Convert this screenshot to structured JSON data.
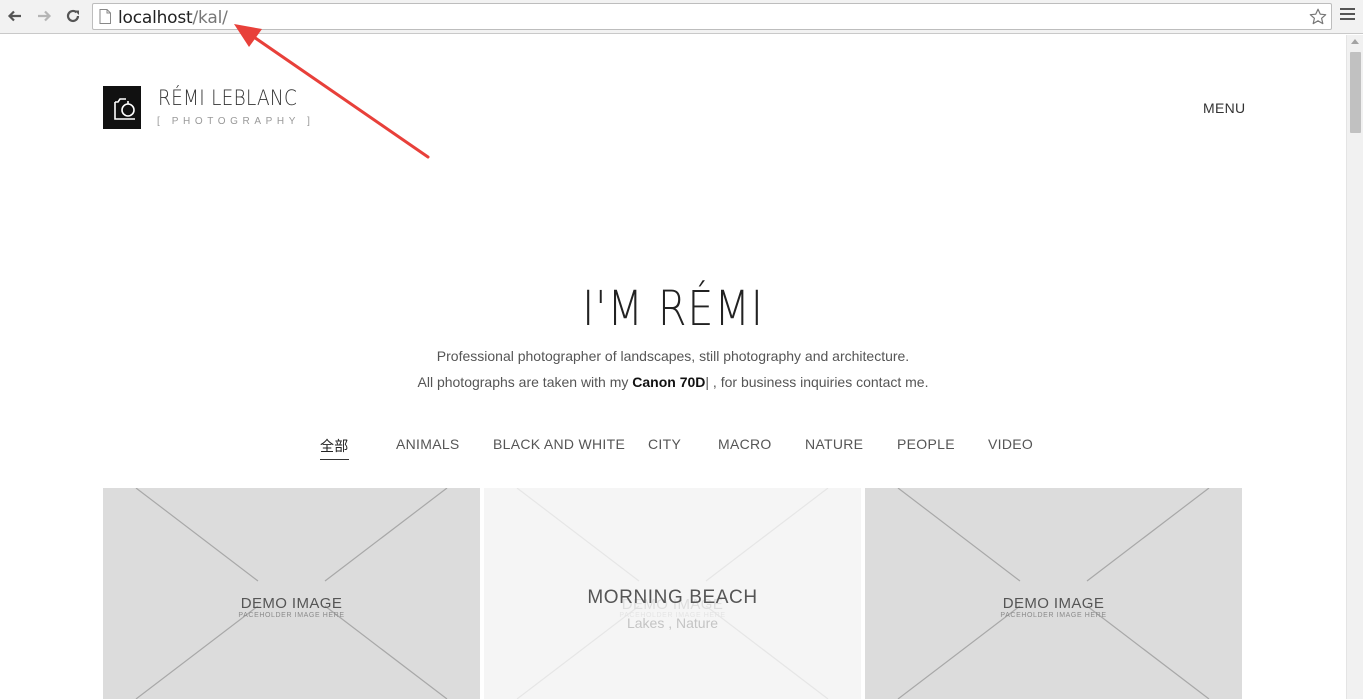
{
  "browser": {
    "url_host": "localhost",
    "url_path": "/kal/",
    "icons": {
      "back": "arrow-left-icon",
      "forward": "arrow-right-icon",
      "reload": "reload-icon",
      "page": "page-icon",
      "bookmark": "star-icon",
      "menu": "hamburger-menu-icon"
    }
  },
  "header": {
    "brand_name": "RÉMI LEBLANC",
    "brand_sub": "[ PHOTOGRAPHY ]",
    "menu_label": "MENU"
  },
  "hero": {
    "title": "I'M RÉMI",
    "line1": "Professional photographer of landscapes, still photography and architecture.",
    "line2_before": "All photographs are taken with my ",
    "line2_camera": "Canon 70D",
    "line2_after": "| , for business inquiries contact me."
  },
  "filters": [
    {
      "label": "全部",
      "active": true
    },
    {
      "label": "ANIMALS",
      "active": false
    },
    {
      "label": "BLACK AND WHITE",
      "active": false
    },
    {
      "label": "CITY",
      "active": false
    },
    {
      "label": "MACRO",
      "active": false
    },
    {
      "label": "NATURE",
      "active": false
    },
    {
      "label": "PEOPLE",
      "active": false
    },
    {
      "label": "VIDEO",
      "active": false
    }
  ],
  "gallery": [
    {
      "placeholder_title": "DEMO IMAGE",
      "placeholder_sub": "PACEHOLDER IMAGE HERE"
    },
    {
      "placeholder_title": "DEMO IMAGE",
      "placeholder_sub": "PACEHOLDER IMAGE HERE",
      "hover_title": "MORNING BEACH",
      "hover_tags": "Lakes , Nature"
    },
    {
      "placeholder_title": "DEMO IMAGE",
      "placeholder_sub": "PACEHOLDER IMAGE HERE"
    }
  ],
  "colors": {
    "tile_bg": "#dcdcdc",
    "tile_hover_bg": "#f5f5f5",
    "annotation_arrow": "#e8403a"
  }
}
